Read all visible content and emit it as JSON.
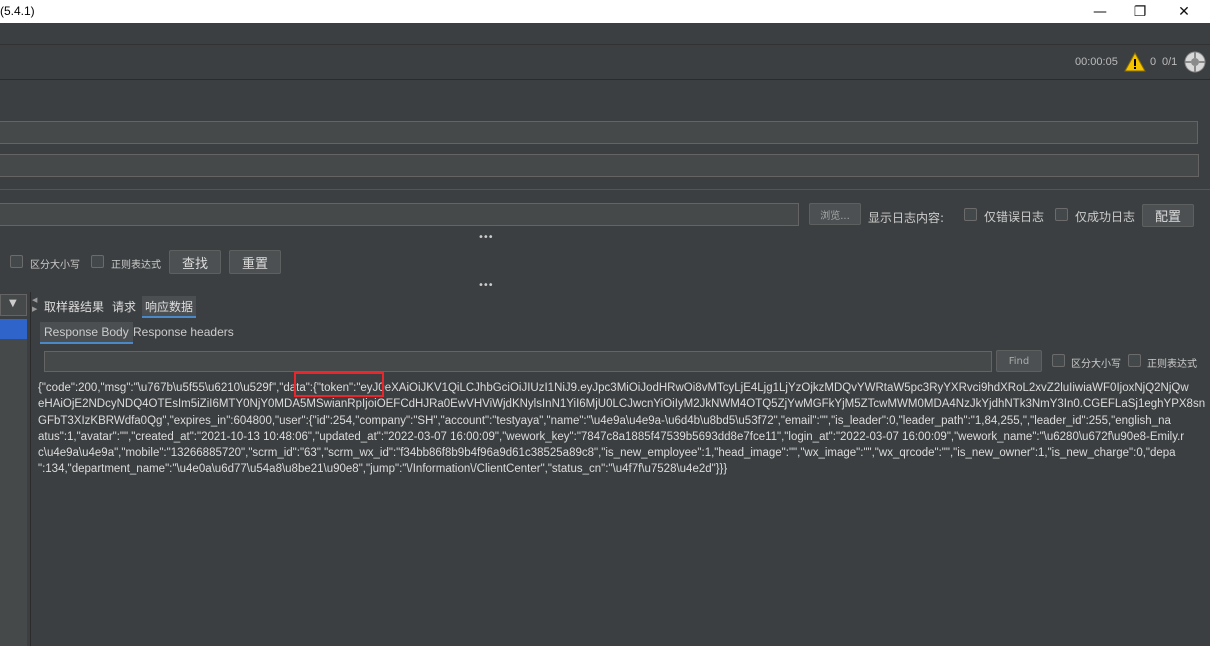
{
  "window": {
    "title": "(5.4.1)",
    "controls": {
      "minimize": "—",
      "maximize": "❐",
      "close": "✕"
    }
  },
  "status": {
    "elapsed": "00:00:05",
    "error_count": "0",
    "threads": "0/1",
    "warning_icon": "warning-triangle-icon",
    "remote_icon": "globe-icon"
  },
  "log": {
    "browse_label": "浏览...",
    "display_label": "显示日志内容:",
    "errors_only_label": "仅错误日志",
    "success_only_label": "仅成功日志",
    "configure_label": "配置"
  },
  "search_bar": {
    "case_sensitive_label": "区分大小写",
    "regex_label": "正则表达式",
    "find_label": "查找",
    "reset_label": "重置"
  },
  "result_tabs": [
    "取样器结果",
    "请求",
    "响应数据"
  ],
  "response_tabs": [
    "Response Body",
    "Response headers"
  ],
  "response_search": {
    "find_label": "Find",
    "case_sensitive_label": "区分大小写",
    "regex_label": "正则表达式"
  },
  "response_body": {
    "lines": [
      "{\"code\":200,\"msg\":\"\\u767b\\u5f55\\u6210\\u529f\",\"data\":{\"token\":\"eyJ0eXAiOiJKV1QiLCJhbGciOiJIUzI1NiJ9.eyJpc3MiOiJodHRwOi8vMTcyLjE4Ljg1LjYzOjkzMDQvYWRtaW5pc3RyYXRvci9hdXRoL2xvZ2luIiwiaWF0IjoxNjQ2NjQw",
      "eHAiOjE2NDcyNDQ4OTEsIm5iZiI6MTY0NjY0MDA5MSwianRpIjoiOEFCdHJRa0EwVHViWjdKNylsInN1YiI6MjU0LCJwcnYiOiIyM2JkNWM4OTQ5ZjYwMGFkYjM5ZTcwMWM0MDA4NzJkYjdhNTk3NmY3In0.CGEFLaSj1eghYPX8sn",
      "GFbT3XIzKBRWdfa0Qg\",\"expires_in\":604800,\"user\":{\"id\":254,\"company\":\"SH\",\"account\":\"testyaya\",\"name\":\"\\u4e9a\\u4e9a-\\u6d4b\\u8bd5\\u53f72\",\"email\":\"\",\"is_leader\":0,\"leader_path\":\"1,84,255,\",\"leader_id\":255,\"english_na",
      "atus\":1,\"avatar\":\"\",\"created_at\":\"2021-10-13 10:48:06\",\"updated_at\":\"2022-03-07 16:00:09\",\"wework_key\":\"7847c8a1885f47539b5693dd8e7fce11\",\"login_at\":\"2022-03-07 16:00:09\",\"wework_name\":\"\\u6280\\u672f\\u90e8-Emily.r",
      "c\\u4e9a\\u4e9a\",\"mobile\":\"13266885720\",\"scrm_id\":\"63\",\"scrm_wx_id\":\"f34bb86f8b9b4f96a9d61c38525a89c8\",\"is_new_employee\":1,\"head_image\":\"\",\"wx_image\":\"\",\"wx_qrcode\":\"\",\"is_new_owner\":1,\"is_new_charge\":0,\"depa",
      "\":134,\"department_name\":\"\\u4e0a\\u6d77\\u54a8\\u8be21\\u90e8\",\"jump\":\"\\/Information\\/ClientCenter\",\"status_cn\":\"\\u4f7f\\u7528\\u4e2d\"}}}"
    ]
  }
}
